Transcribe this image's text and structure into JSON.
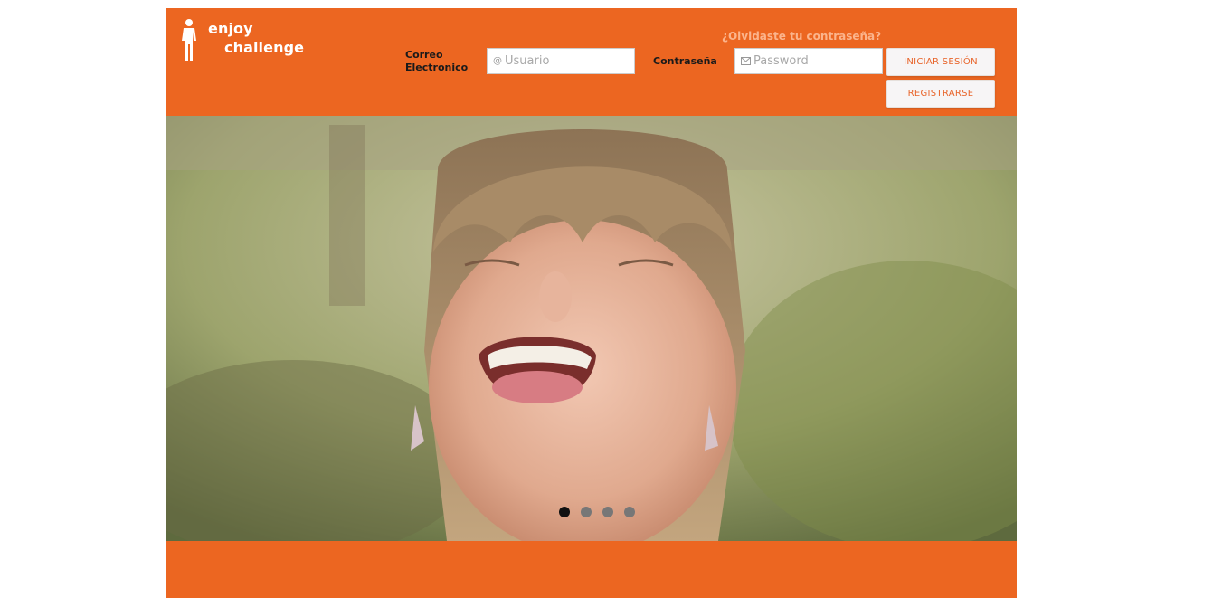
{
  "header": {
    "logo": {
      "line1": "enjoy",
      "line2": "challenge"
    },
    "forgot_password": "¿Olvidaste tu contraseña?",
    "email_label": "Correo Electronico",
    "email_placeholder": "Usuario",
    "password_label": "Contraseña",
    "password_placeholder": "Password",
    "login_button": "INICIAR SESIÓN",
    "register_button": "REGISTRARSE"
  },
  "carousel": {
    "slide_count": 4,
    "active_index": 0
  },
  "colors": {
    "brand_orange": "#ec6621",
    "button_text": "#e8642a",
    "forgot_link": "#fbb48c"
  }
}
